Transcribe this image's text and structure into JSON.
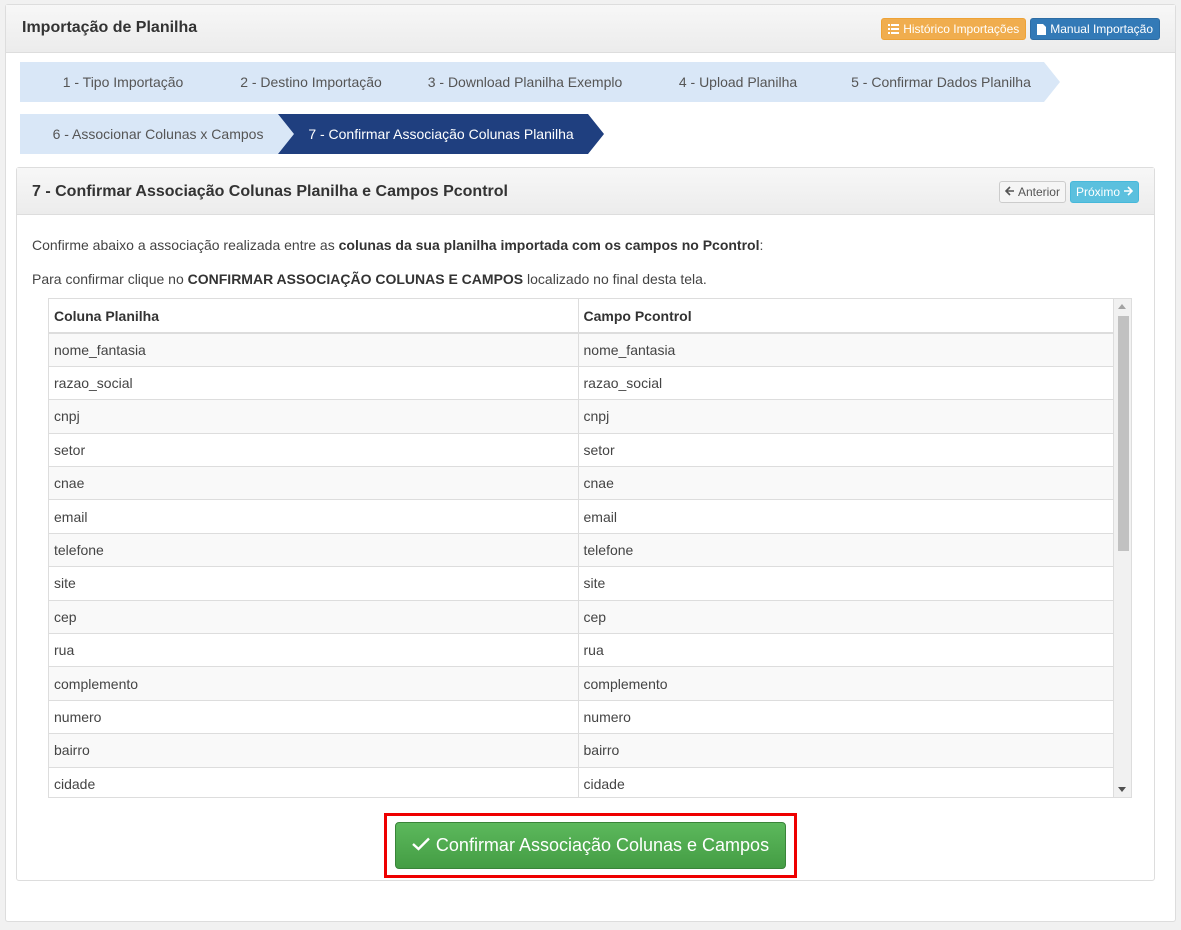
{
  "header": {
    "title": "Importação de Planilha",
    "history_button": "Histórico Importações",
    "manual_button": "Manual Importação"
  },
  "steps": [
    {
      "label": "1 - Tipo Importação"
    },
    {
      "label": "2 - Destino Importação"
    },
    {
      "label": "3 - Download Planilha Exemplo"
    },
    {
      "label": "4 - Upload Planilha"
    },
    {
      "label": "5 - Confirmar Dados Planilha"
    },
    {
      "label": "6 - Associonar Colunas x Campos"
    },
    {
      "label": "7 - Confirmar Associação Colunas Planilha"
    }
  ],
  "panel": {
    "title": "7 - Confirmar Associação Colunas Planilha e Campos Pcontrol",
    "prev_button": "Anterior",
    "next_button": "Próximo",
    "para1_prefix": "Confirme abaixo a associação realizada entre as ",
    "para1_bold": "colunas da sua planilha importada com os campos no Pcontrol",
    "para1_suffix": ":",
    "para2_prefix": "Para confirmar clique no ",
    "para2_bold": "CONFIRMAR ASSOCIAÇÃO COLUNAS E CAMPOS",
    "para2_suffix": " localizado no final desta tela."
  },
  "table": {
    "headers": [
      "Coluna Planilha",
      "Campo Pcontrol"
    ],
    "rows": [
      [
        "nome_fantasia",
        "nome_fantasia"
      ],
      [
        "razao_social",
        "razao_social"
      ],
      [
        "cnpj",
        "cnpj"
      ],
      [
        "setor",
        "setor"
      ],
      [
        "cnae",
        "cnae"
      ],
      [
        "email",
        "email"
      ],
      [
        "telefone",
        "telefone"
      ],
      [
        "site",
        "site"
      ],
      [
        "cep",
        "cep"
      ],
      [
        "rua",
        "rua"
      ],
      [
        "complemento",
        "complemento"
      ],
      [
        "numero",
        "numero"
      ],
      [
        "bairro",
        "bairro"
      ],
      [
        "cidade",
        "cidade"
      ]
    ]
  },
  "confirm_button": "Confirmar Associação Colunas e Campos",
  "colors": {
    "step_inactive": "#d9e7f7",
    "step_active": "#1f3f7f",
    "confirm_green": "#4cae4c",
    "highlight_red": "#ee0000"
  }
}
